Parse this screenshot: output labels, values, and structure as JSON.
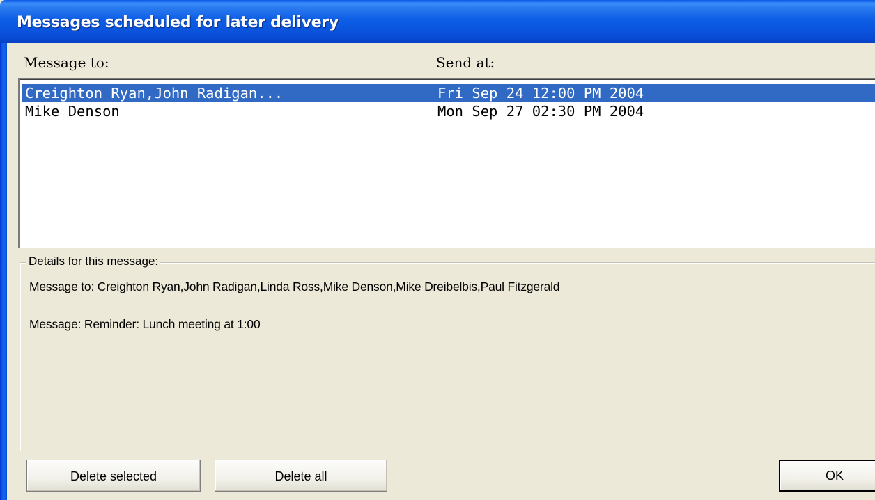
{
  "window": {
    "title": "Messages scheduled for later delivery"
  },
  "list": {
    "headers": {
      "to": "Message to:",
      "at": "Send at:"
    },
    "rows": [
      {
        "to": "Creighton Ryan,John Radigan...",
        "at": "Fri Sep 24 12:00 PM 2004",
        "selected": true
      },
      {
        "to": "Mike Denson",
        "at": "Mon Sep 27 02:30 PM 2004",
        "selected": false
      }
    ]
  },
  "details": {
    "legend": "Details for this message:",
    "message_to": "Message to: Creighton Ryan,John Radigan,Linda Ross,Mike Denson,Mike Dreibelbis,Paul Fitzgerald",
    "message": "Message: Reminder: Lunch meeting at 1:00"
  },
  "buttons": {
    "delete_selected": "Delete selected",
    "delete_all": "Delete all",
    "ok": "OK"
  },
  "colors": {
    "titlebar": "#0a58e8",
    "selection": "#316ac5",
    "face": "#ece9d8"
  }
}
